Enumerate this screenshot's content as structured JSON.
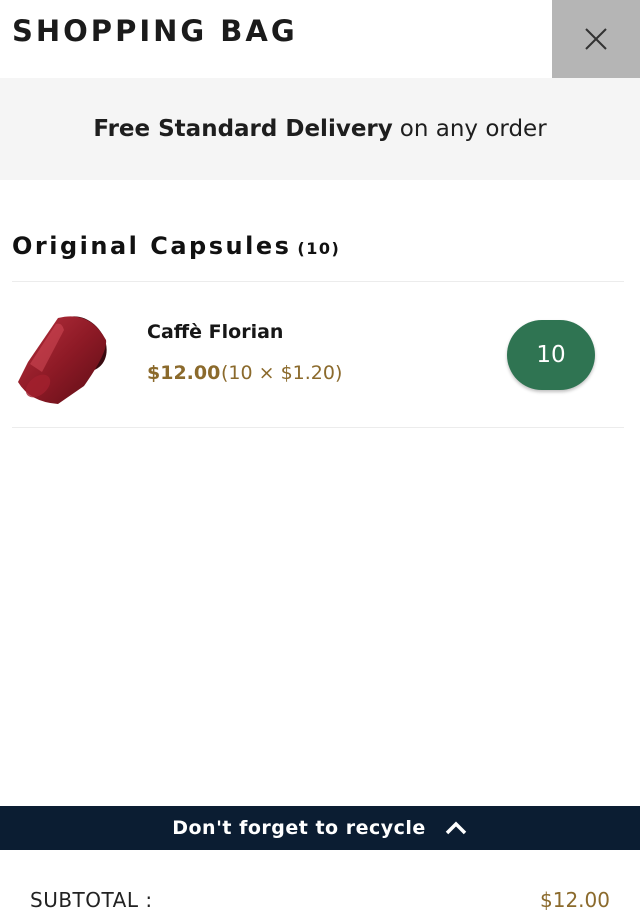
{
  "header": {
    "title": "SHOPPING BAG",
    "close_icon": "close-icon"
  },
  "delivery": {
    "strong": "Free Standard Delivery",
    "rest": "on any order"
  },
  "section": {
    "title": "Original Capsules",
    "count": "(10)"
  },
  "item": {
    "name": "Caffè Florian",
    "price": "$12.00",
    "unit": "(10 × $1.20)",
    "quantity": "10",
    "image_icon": "coffee-capsule-red",
    "qty_color": "#2f7452"
  },
  "recycle": {
    "label": "Don't forget to recycle",
    "icon": "chevron-up-icon",
    "bg": "#0b1d32"
  },
  "subtotal": {
    "label": "SUBTOTAL :",
    "value": "$12.00"
  },
  "colors": {
    "price": "#8b6a2c",
    "close_bg": "#b5b5b5"
  }
}
